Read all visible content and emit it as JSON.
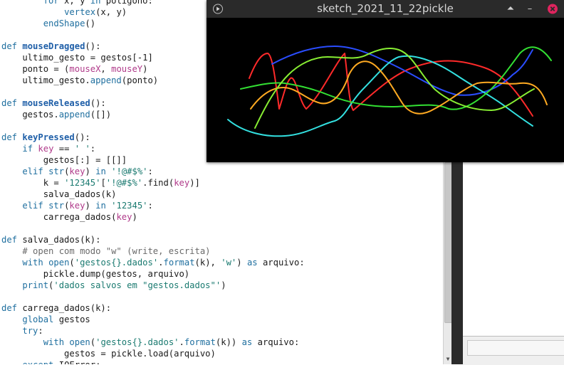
{
  "editor": {
    "lines": [
      [
        [
          "",
          "        "
        ],
        [
          "kw",
          "for"
        ],
        [
          "",
          " x, y "
        ],
        [
          "kw",
          "in"
        ],
        [
          "",
          " poligono:"
        ]
      ],
      [
        [
          "",
          "            "
        ],
        [
          "bi",
          "vertex"
        ],
        [
          "",
          "(x, y)"
        ]
      ],
      [
        [
          "",
          "        "
        ],
        [
          "bi",
          "endShape"
        ],
        [
          "",
          "()"
        ]
      ],
      [],
      [
        [
          "kw",
          "def"
        ],
        [
          "",
          " "
        ],
        [
          "fn",
          "mouseDragged"
        ],
        [
          "",
          "():"
        ]
      ],
      [
        [
          "",
          "    ultimo_gesto = gestos[-1]"
        ]
      ],
      [
        [
          "",
          "    ponto = ("
        ],
        [
          "vr",
          "mouseX"
        ],
        [
          "",
          ", "
        ],
        [
          "vr",
          "mouseY"
        ],
        [
          "",
          ")"
        ]
      ],
      [
        [
          "",
          "    ultimo_gesto."
        ],
        [
          "bi",
          "append"
        ],
        [
          "",
          "(ponto)"
        ]
      ],
      [],
      [
        [
          "kw",
          "def"
        ],
        [
          "",
          " "
        ],
        [
          "fn",
          "mouseReleased"
        ],
        [
          "",
          "():"
        ]
      ],
      [
        [
          "",
          "    gestos."
        ],
        [
          "bi",
          "append"
        ],
        [
          "",
          "([])"
        ]
      ],
      [],
      [
        [
          "kw",
          "def"
        ],
        [
          "",
          " "
        ],
        [
          "fn",
          "keyPressed"
        ],
        [
          "",
          "():"
        ]
      ],
      [
        [
          "",
          "    "
        ],
        [
          "kw",
          "if"
        ],
        [
          "",
          " "
        ],
        [
          "vr",
          "key"
        ],
        [
          "",
          " == "
        ],
        [
          "st",
          "' '"
        ],
        [
          "",
          ":"
        ]
      ],
      [
        [
          "",
          "        gestos[:] = [[]]"
        ]
      ],
      [
        [
          "",
          "    "
        ],
        [
          "kw",
          "elif"
        ],
        [
          "",
          " "
        ],
        [
          "bi",
          "str"
        ],
        [
          "",
          "("
        ],
        [
          "vr",
          "key"
        ],
        [
          "",
          ") "
        ],
        [
          "kw",
          "in"
        ],
        [
          "",
          " "
        ],
        [
          "st",
          "'!@#$%'"
        ],
        [
          "",
          ":"
        ]
      ],
      [
        [
          "",
          "        k = "
        ],
        [
          "st",
          "'12345'"
        ],
        [
          "",
          "["
        ],
        [
          "st",
          "'!@#$%'"
        ],
        [
          "",
          ".find("
        ],
        [
          "vr",
          "key"
        ],
        [
          "",
          ")]"
        ]
      ],
      [
        [
          "",
          "        salva_dados(k)"
        ]
      ],
      [
        [
          "",
          "    "
        ],
        [
          "kw",
          "elif"
        ],
        [
          "",
          " "
        ],
        [
          "bi",
          "str"
        ],
        [
          "",
          "("
        ],
        [
          "vr",
          "key"
        ],
        [
          "",
          ") "
        ],
        [
          "kw",
          "in"
        ],
        [
          "",
          " "
        ],
        [
          "st",
          "'12345'"
        ],
        [
          "",
          ":"
        ]
      ],
      [
        [
          "",
          "        carrega_dados("
        ],
        [
          "vr",
          "key"
        ],
        [
          "",
          ")"
        ]
      ],
      [],
      [
        [
          "kw",
          "def"
        ],
        [
          "",
          " salva_dados(k):"
        ]
      ],
      [
        [
          "",
          "    "
        ],
        [
          "cm",
          "# open com modo \"w\" (write, escrita)"
        ]
      ],
      [
        [
          "",
          "    "
        ],
        [
          "kw",
          "with"
        ],
        [
          "",
          " "
        ],
        [
          "bi",
          "open"
        ],
        [
          "",
          "("
        ],
        [
          "st",
          "'gestos{}.dados'"
        ],
        [
          "",
          "."
        ],
        [
          "bi",
          "format"
        ],
        [
          "",
          "(k), "
        ],
        [
          "st",
          "'w'"
        ],
        [
          "",
          ") "
        ],
        [
          "kw",
          "as"
        ],
        [
          "",
          " arquivo:"
        ]
      ],
      [
        [
          "",
          "        pickle.dump(gestos, arquivo)"
        ]
      ],
      [
        [
          "",
          "    "
        ],
        [
          "kw",
          "print"
        ],
        [
          "",
          "("
        ],
        [
          "st",
          "'dados salvos em \"gestos.dados\"'"
        ],
        [
          "",
          ")"
        ]
      ],
      [],
      [
        [
          "kw",
          "def"
        ],
        [
          "",
          " carrega_dados(k):"
        ]
      ],
      [
        [
          "",
          "    "
        ],
        [
          "kw",
          "global"
        ],
        [
          "",
          " gestos"
        ]
      ],
      [
        [
          "",
          "    "
        ],
        [
          "kw",
          "try"
        ],
        [
          "",
          ":"
        ]
      ],
      [
        [
          "",
          "        "
        ],
        [
          "kw",
          "with"
        ],
        [
          "",
          " "
        ],
        [
          "bi",
          "open"
        ],
        [
          "",
          "("
        ],
        [
          "st",
          "'gestos{}.dados'"
        ],
        [
          "",
          "."
        ],
        [
          "bi",
          "format"
        ],
        [
          "",
          "(k)) "
        ],
        [
          "kw",
          "as"
        ],
        [
          "",
          " arquivo:"
        ]
      ],
      [
        [
          "",
          "            gestos = pickle.load(arquivo)"
        ]
      ],
      [
        [
          "",
          "    "
        ],
        [
          "kw",
          "except"
        ],
        [
          "",
          " IOError:"
        ]
      ]
    ]
  },
  "sketch_window": {
    "title": "sketch_2021_11_22pickle",
    "play_icon": "play-icon",
    "buttons": [
      {
        "name": "maximize-button",
        "icon": "caret-up-icon",
        "glyph": "⏶"
      },
      {
        "name": "minimize-button",
        "icon": "minus-icon",
        "glyph": "–"
      },
      {
        "name": "close-button",
        "icon": "close-icon",
        "glyph": "✕"
      }
    ],
    "close_color": "#e0245e",
    "stroke_colors": [
      "#ff2a2a",
      "#2a4dff",
      "#33e0e0",
      "#33e033",
      "#ffaa22",
      "#88ee33"
    ]
  },
  "scrollbar": {
    "down_arrow": "▼"
  }
}
